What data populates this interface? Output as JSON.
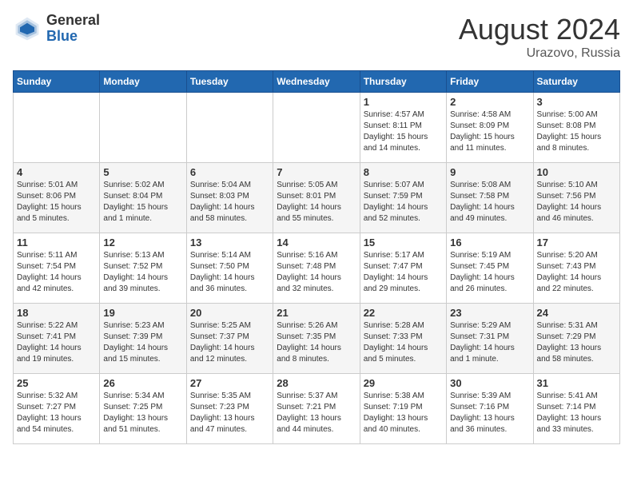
{
  "header": {
    "logo_general": "General",
    "logo_blue": "Blue",
    "month_year": "August 2024",
    "location": "Urazovo, Russia"
  },
  "weekdays": [
    "Sunday",
    "Monday",
    "Tuesday",
    "Wednesday",
    "Thursday",
    "Friday",
    "Saturday"
  ],
  "weeks": [
    [
      {
        "day": "",
        "info": ""
      },
      {
        "day": "",
        "info": ""
      },
      {
        "day": "",
        "info": ""
      },
      {
        "day": "",
        "info": ""
      },
      {
        "day": "1",
        "info": "Sunrise: 4:57 AM\nSunset: 8:11 PM\nDaylight: 15 hours\nand 14 minutes."
      },
      {
        "day": "2",
        "info": "Sunrise: 4:58 AM\nSunset: 8:09 PM\nDaylight: 15 hours\nand 11 minutes."
      },
      {
        "day": "3",
        "info": "Sunrise: 5:00 AM\nSunset: 8:08 PM\nDaylight: 15 hours\nand 8 minutes."
      }
    ],
    [
      {
        "day": "4",
        "info": "Sunrise: 5:01 AM\nSunset: 8:06 PM\nDaylight: 15 hours\nand 5 minutes."
      },
      {
        "day": "5",
        "info": "Sunrise: 5:02 AM\nSunset: 8:04 PM\nDaylight: 15 hours\nand 1 minute."
      },
      {
        "day": "6",
        "info": "Sunrise: 5:04 AM\nSunset: 8:03 PM\nDaylight: 14 hours\nand 58 minutes."
      },
      {
        "day": "7",
        "info": "Sunrise: 5:05 AM\nSunset: 8:01 PM\nDaylight: 14 hours\nand 55 minutes."
      },
      {
        "day": "8",
        "info": "Sunrise: 5:07 AM\nSunset: 7:59 PM\nDaylight: 14 hours\nand 52 minutes."
      },
      {
        "day": "9",
        "info": "Sunrise: 5:08 AM\nSunset: 7:58 PM\nDaylight: 14 hours\nand 49 minutes."
      },
      {
        "day": "10",
        "info": "Sunrise: 5:10 AM\nSunset: 7:56 PM\nDaylight: 14 hours\nand 46 minutes."
      }
    ],
    [
      {
        "day": "11",
        "info": "Sunrise: 5:11 AM\nSunset: 7:54 PM\nDaylight: 14 hours\nand 42 minutes."
      },
      {
        "day": "12",
        "info": "Sunrise: 5:13 AM\nSunset: 7:52 PM\nDaylight: 14 hours\nand 39 minutes."
      },
      {
        "day": "13",
        "info": "Sunrise: 5:14 AM\nSunset: 7:50 PM\nDaylight: 14 hours\nand 36 minutes."
      },
      {
        "day": "14",
        "info": "Sunrise: 5:16 AM\nSunset: 7:48 PM\nDaylight: 14 hours\nand 32 minutes."
      },
      {
        "day": "15",
        "info": "Sunrise: 5:17 AM\nSunset: 7:47 PM\nDaylight: 14 hours\nand 29 minutes."
      },
      {
        "day": "16",
        "info": "Sunrise: 5:19 AM\nSunset: 7:45 PM\nDaylight: 14 hours\nand 26 minutes."
      },
      {
        "day": "17",
        "info": "Sunrise: 5:20 AM\nSunset: 7:43 PM\nDaylight: 14 hours\nand 22 minutes."
      }
    ],
    [
      {
        "day": "18",
        "info": "Sunrise: 5:22 AM\nSunset: 7:41 PM\nDaylight: 14 hours\nand 19 minutes."
      },
      {
        "day": "19",
        "info": "Sunrise: 5:23 AM\nSunset: 7:39 PM\nDaylight: 14 hours\nand 15 minutes."
      },
      {
        "day": "20",
        "info": "Sunrise: 5:25 AM\nSunset: 7:37 PM\nDaylight: 14 hours\nand 12 minutes."
      },
      {
        "day": "21",
        "info": "Sunrise: 5:26 AM\nSunset: 7:35 PM\nDaylight: 14 hours\nand 8 minutes."
      },
      {
        "day": "22",
        "info": "Sunrise: 5:28 AM\nSunset: 7:33 PM\nDaylight: 14 hours\nand 5 minutes."
      },
      {
        "day": "23",
        "info": "Sunrise: 5:29 AM\nSunset: 7:31 PM\nDaylight: 14 hours\nand 1 minute."
      },
      {
        "day": "24",
        "info": "Sunrise: 5:31 AM\nSunset: 7:29 PM\nDaylight: 13 hours\nand 58 minutes."
      }
    ],
    [
      {
        "day": "25",
        "info": "Sunrise: 5:32 AM\nSunset: 7:27 PM\nDaylight: 13 hours\nand 54 minutes."
      },
      {
        "day": "26",
        "info": "Sunrise: 5:34 AM\nSunset: 7:25 PM\nDaylight: 13 hours\nand 51 minutes."
      },
      {
        "day": "27",
        "info": "Sunrise: 5:35 AM\nSunset: 7:23 PM\nDaylight: 13 hours\nand 47 minutes."
      },
      {
        "day": "28",
        "info": "Sunrise: 5:37 AM\nSunset: 7:21 PM\nDaylight: 13 hours\nand 44 minutes."
      },
      {
        "day": "29",
        "info": "Sunrise: 5:38 AM\nSunset: 7:19 PM\nDaylight: 13 hours\nand 40 minutes."
      },
      {
        "day": "30",
        "info": "Sunrise: 5:39 AM\nSunset: 7:16 PM\nDaylight: 13 hours\nand 36 minutes."
      },
      {
        "day": "31",
        "info": "Sunrise: 5:41 AM\nSunset: 7:14 PM\nDaylight: 13 hours\nand 33 minutes."
      }
    ]
  ]
}
